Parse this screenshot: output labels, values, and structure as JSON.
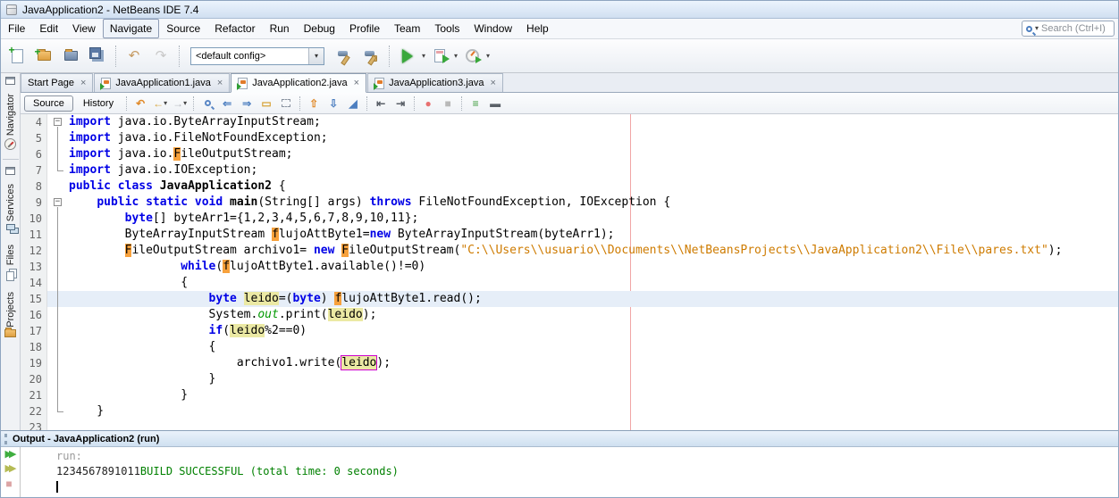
{
  "window": {
    "title": "JavaApplication2 - NetBeans IDE 7.4"
  },
  "menubar": {
    "items": [
      "File",
      "Edit",
      "View",
      "Navigate",
      "Source",
      "Refactor",
      "Run",
      "Debug",
      "Profile",
      "Team",
      "Tools",
      "Window",
      "Help"
    ],
    "focused": "Navigate",
    "search_placeholder": "Search (Ctrl+I)"
  },
  "toolbar": {
    "config_value": "<default config>",
    "buttons": [
      "new-file",
      "new-project",
      "open-project",
      "save-all",
      "undo",
      "redo",
      "configuration-combo",
      "build-project",
      "clean-and-build-project",
      "run-project",
      "debug-project",
      "profile-project"
    ]
  },
  "tabs": [
    {
      "label": "Start Page",
      "icon": false,
      "active": false
    },
    {
      "label": "JavaApplication1.java",
      "icon": true,
      "active": false
    },
    {
      "label": "JavaApplication2.java",
      "icon": true,
      "active": true
    },
    {
      "label": "JavaApplication3.java",
      "icon": true,
      "active": false
    }
  ],
  "editor_toolbar": {
    "source_label": "Source",
    "history_label": "History",
    "icons": [
      "last-edit",
      "back",
      "forward",
      "find",
      "previous-occurrence",
      "next-occurrence",
      "toggle-highlight",
      "rectangular-selection",
      "previous-bookmark",
      "next-bookmark",
      "toggle-bookmark",
      "shift-left",
      "shift-right",
      "start-macro-recording",
      "stop-macro-recording",
      "comment",
      "uncomment"
    ]
  },
  "sidebar": {
    "top": [
      {
        "label": "Navigator",
        "icon": "compass-icon"
      }
    ],
    "bottom": [
      {
        "label": "Services",
        "icon": "services-icon"
      },
      {
        "label": "Files",
        "icon": "files-icon"
      },
      {
        "label": "Projects",
        "icon": "projects-icon"
      }
    ]
  },
  "colors": {
    "keyword": "#0000e6",
    "string": "#ce7b00",
    "field": "#009900",
    "occurrence_f_highlight": "#f7a13c",
    "occurrence_leido_highlight": "#ebe9a4",
    "caret_occurrence_border": "#cc00cc",
    "current_line": "#e6eef8",
    "right_margin": "#f0a5a5",
    "success_green": "#008000"
  },
  "editor": {
    "lines": [
      {
        "n": 4,
        "fold": "start",
        "cur": false,
        "segs": [
          [
            "k",
            "import"
          ],
          [
            "p",
            " java.io.ByteArrayInputStream;"
          ]
        ]
      },
      {
        "n": 5,
        "fold": "mid",
        "cur": false,
        "segs": [
          [
            "k",
            "import"
          ],
          [
            "p",
            " java.io.FileNotFoundException;"
          ]
        ]
      },
      {
        "n": 6,
        "fold": "mid",
        "cur": false,
        "segs": [
          [
            "k",
            "import"
          ],
          [
            "p",
            " java.io."
          ],
          [
            "F",
            "F"
          ],
          [
            "p",
            "ileOutputStream;"
          ]
        ]
      },
      {
        "n": 7,
        "fold": "end",
        "cur": false,
        "segs": [
          [
            "k",
            "import"
          ],
          [
            "p",
            " java.io.IOException;"
          ]
        ]
      },
      {
        "n": 8,
        "fold": "",
        "cur": false,
        "segs": [
          [
            "k",
            "public"
          ],
          [
            "p",
            " "
          ],
          [
            "k",
            "class"
          ],
          [
            "p",
            " "
          ],
          [
            "b",
            "JavaApplication2"
          ],
          [
            "p",
            " {"
          ]
        ]
      },
      {
        "n": 9,
        "fold": "start",
        "cur": false,
        "segs": [
          [
            "p",
            "    "
          ],
          [
            "k",
            "public"
          ],
          [
            "p",
            " "
          ],
          [
            "k",
            "static"
          ],
          [
            "p",
            " "
          ],
          [
            "k",
            "void"
          ],
          [
            "p",
            " "
          ],
          [
            "b",
            "main"
          ],
          [
            "p",
            "(String[] args) "
          ],
          [
            "k",
            "throws"
          ],
          [
            "p",
            " FileNotFoundException, IOException {"
          ]
        ]
      },
      {
        "n": 10,
        "fold": "mid",
        "cur": false,
        "segs": [
          [
            "p",
            "        "
          ],
          [
            "k",
            "byte"
          ],
          [
            "p",
            "[] byteArr1={1,2,3,4,5,6,7,8,9,10,11};"
          ]
        ]
      },
      {
        "n": 11,
        "fold": "mid",
        "cur": false,
        "segs": [
          [
            "p",
            "        ByteArrayInputStream "
          ],
          [
            "F",
            "f"
          ],
          [
            "p",
            "lujoAttByte1="
          ],
          [
            "k",
            "new"
          ],
          [
            "p",
            " ByteArrayInputStream(byteArr1);"
          ]
        ]
      },
      {
        "n": 12,
        "fold": "mid",
        "cur": false,
        "segs": [
          [
            "p",
            "        "
          ],
          [
            "F",
            "F"
          ],
          [
            "p",
            "ileOutputStream archivo1= "
          ],
          [
            "k",
            "new"
          ],
          [
            "p",
            " "
          ],
          [
            "F",
            "F"
          ],
          [
            "p",
            "ileOutputStream("
          ],
          [
            "s",
            "\"C:\\\\Users\\\\usuario\\\\Documents\\\\NetBeansProjects\\\\JavaApplication2\\\\File\\\\pares.txt\""
          ],
          [
            "p",
            ");"
          ]
        ]
      },
      {
        "n": 13,
        "fold": "mid",
        "cur": false,
        "segs": [
          [
            "p",
            "                "
          ],
          [
            "k",
            "while"
          ],
          [
            "p",
            "("
          ],
          [
            "F",
            "f"
          ],
          [
            "p",
            "lujoAttByte1.available()!=0)"
          ]
        ]
      },
      {
        "n": 14,
        "fold": "mid",
        "cur": false,
        "segs": [
          [
            "p",
            "                {"
          ]
        ]
      },
      {
        "n": 15,
        "fold": "mid",
        "cur": true,
        "segs": [
          [
            "p",
            "                    "
          ],
          [
            "k",
            "byte"
          ],
          [
            "p",
            " "
          ],
          [
            "L",
            "leido"
          ],
          [
            "p",
            "=("
          ],
          [
            "k",
            "byte"
          ],
          [
            "p",
            ") "
          ],
          [
            "F",
            "f"
          ],
          [
            "p",
            "lujoAttByte1.read();"
          ]
        ]
      },
      {
        "n": 16,
        "fold": "mid",
        "cur": false,
        "segs": [
          [
            "p",
            "                    System."
          ],
          [
            "f",
            "out"
          ],
          [
            "p",
            ".print("
          ],
          [
            "L",
            "leido"
          ],
          [
            "p",
            ");"
          ]
        ]
      },
      {
        "n": 17,
        "fold": "mid",
        "cur": false,
        "segs": [
          [
            "p",
            "                    "
          ],
          [
            "k",
            "if"
          ],
          [
            "p",
            "("
          ],
          [
            "L",
            "leido"
          ],
          [
            "p",
            "%2==0)"
          ]
        ]
      },
      {
        "n": 18,
        "fold": "mid",
        "cur": false,
        "segs": [
          [
            "p",
            "                    {"
          ]
        ]
      },
      {
        "n": 19,
        "fold": "mid",
        "cur": false,
        "segs": [
          [
            "p",
            "                        archivo1.write("
          ],
          [
            "C",
            "leido"
          ],
          [
            "p",
            ");"
          ]
        ]
      },
      {
        "n": 20,
        "fold": "mid",
        "cur": false,
        "segs": [
          [
            "p",
            "                    }"
          ]
        ]
      },
      {
        "n": 21,
        "fold": "mid",
        "cur": false,
        "segs": [
          [
            "p",
            "                }"
          ]
        ]
      },
      {
        "n": 22,
        "fold": "end",
        "cur": false,
        "segs": [
          [
            "p",
            "    }"
          ]
        ]
      },
      {
        "n": 23,
        "fold": "",
        "cur": false,
        "segs": [
          [
            "p",
            ""
          ]
        ]
      }
    ]
  },
  "output": {
    "title": "Output - JavaApplication2 (run)",
    "toolbar": [
      "re-run",
      "re-run-with-different-parameters",
      "stop"
    ],
    "lines": [
      {
        "segs": [
          [
            "o-gray",
            "run:"
          ]
        ],
        "caret": false
      },
      {
        "segs": [
          [
            "o-pl",
            "1234567891011"
          ],
          [
            "o-green",
            "BUILD SUCCESSFUL (total time: 0 seconds)"
          ]
        ],
        "caret": false
      },
      {
        "segs": [],
        "caret": true
      }
    ]
  }
}
